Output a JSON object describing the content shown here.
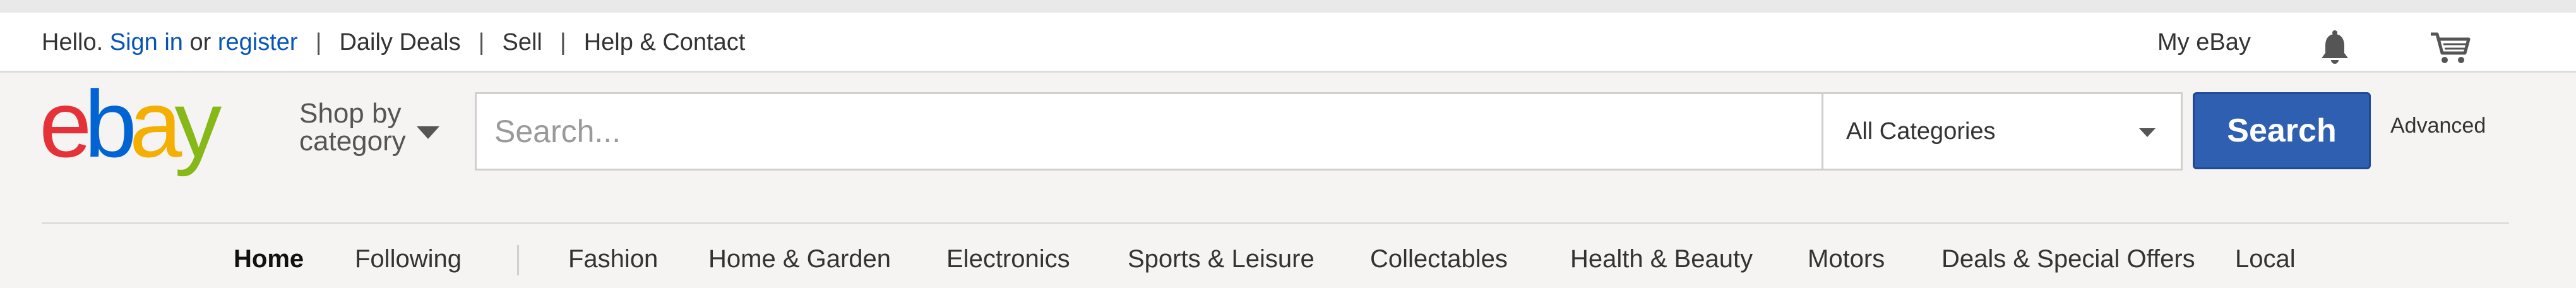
{
  "topbar": {
    "greeting": "Hello.",
    "sign_in": "Sign in",
    "or": "or",
    "register": "register",
    "links": [
      "Daily Deals",
      "Sell",
      "Help & Contact"
    ],
    "my_ebay": "My eBay",
    "icons": [
      "bell-icon",
      "cart-icon"
    ]
  },
  "header": {
    "logo_alt": "ebay",
    "shop_by_line1": "Shop by",
    "shop_by_line2": "category",
    "search_placeholder": "Search...",
    "category_selected": "All Categories",
    "search_button": "Search",
    "advanced": "Advanced"
  },
  "nav": {
    "primary": [
      "Home",
      "Following"
    ],
    "categories": [
      "Fashion",
      "Home & Garden",
      "Electronics",
      "Sports & Leisure",
      "Collectables",
      "Health & Beauty",
      "Motors",
      "Deals & Special Offers",
      "Local"
    ]
  },
  "colors": {
    "link": "#0654ba",
    "search_button": "#2f5fb0",
    "logo_e": "#e53238",
    "logo_b": "#0064d2",
    "logo_a": "#f5af02",
    "logo_y": "#86b817"
  }
}
